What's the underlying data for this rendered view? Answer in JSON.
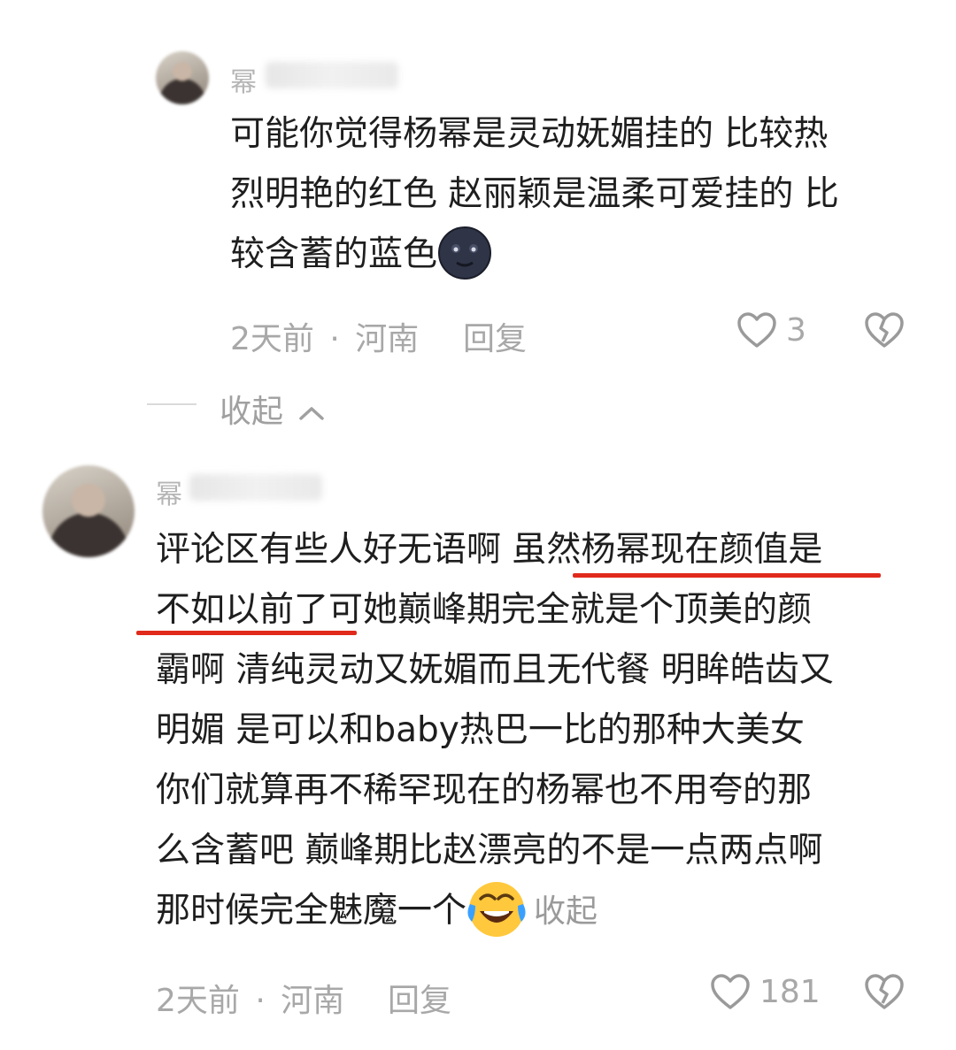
{
  "reply": {
    "username": "幂",
    "text_lines": [
      "可能你觉得杨幂是灵动妩媚挂的 比较热",
      "烈明艳的红色 赵丽颖是温柔可爱挂的 比",
      "较含蓄的蓝色"
    ],
    "emoji": "new-moon-face-emoji",
    "time": "2天前",
    "dot": "·",
    "location": "河南",
    "reply_label": "回复",
    "likes": "3"
  },
  "collapse": {
    "label": "收起"
  },
  "comment": {
    "username": "幂",
    "text_lines": [
      "评论区有些人好无语啊 虽然杨幂现在颜值是",
      "不如以前了可她巅峰期完全就是个顶美的颜",
      "霸啊 清纯灵动又妩媚而且无代餐 明眸皓齿又",
      "明媚 是可以和baby热巴一比的那种大美女",
      "你们就算再不稀罕现在的杨幂也不用夸的那",
      "么含蓄吧 巅峰期比赵漂亮的不是一点两点啊",
      "那时候完全魅魔一个"
    ],
    "emoji": "rolling-laughing-emoji",
    "collapse_inline": "收起",
    "time": "2天前",
    "dot": "·",
    "location": "河南",
    "reply_label": "回复",
    "likes": "181"
  },
  "colors": {
    "underline": "#e02a1c",
    "muted": "#a8a8a8"
  }
}
